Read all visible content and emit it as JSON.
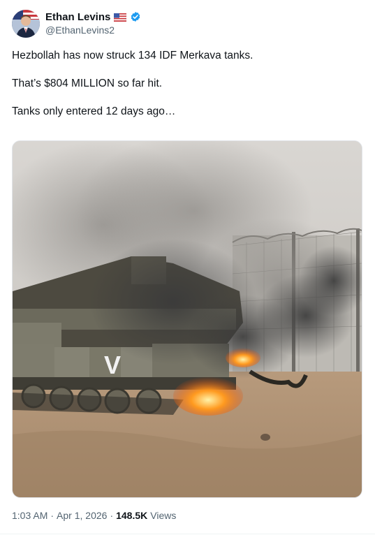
{
  "author": {
    "name": "Ethan Levins",
    "handle": "@EthanLevins2",
    "flag_icon": "us-flag-icon",
    "verified_icon": "verified-badge-icon",
    "verified_color": "#1d9bf0"
  },
  "tweet": {
    "lines": [
      "Hezbollah has now struck 134 IDF Merkava tanks.",
      "That’s $804 MILLION so far hit.",
      "Tanks only entered 12 days ago…"
    ]
  },
  "meta": {
    "time": "1:03 AM",
    "sep1": "·",
    "date": "Apr 1, 2026",
    "sep2": "·",
    "views_count": "148.5K",
    "views_label": "Views"
  },
  "media": {
    "tank_marking": "V"
  }
}
